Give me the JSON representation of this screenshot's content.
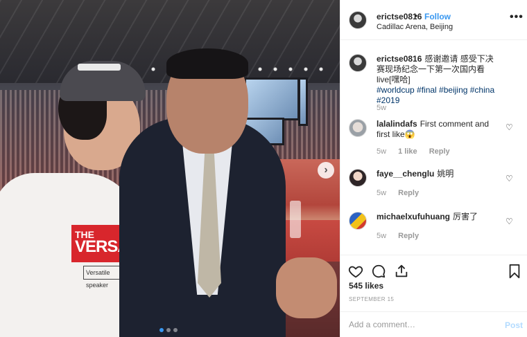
{
  "post": {
    "username": "erictse0816",
    "separator": "•",
    "follow_label": "Follow",
    "location": "Cadillac Arena, Beijing",
    "more_label": "•••"
  },
  "photo": {
    "shirt_line1": "THE",
    "shirt_line2": "VERSACE",
    "shirt_sub": "Versatile speaker",
    "next_glyph": "›",
    "carousel_total": 3,
    "carousel_active": 1
  },
  "caption": {
    "username": "erictse0816",
    "text": "感谢邀请 感受下决赛现场纪念一下第一次国内看live[嘿哈]",
    "hashtags": "#worldcup #final #beijing #china #2019",
    "time": "5w"
  },
  "comments": [
    {
      "username": "lalalindafs",
      "text": "First comment and first like😱",
      "time": "5w",
      "likes": "1 like",
      "reply": "Reply"
    },
    {
      "username": "faye__chenglu",
      "text": "姚明",
      "time": "5w",
      "reply": "Reply"
    },
    {
      "username": "michaelxufuhuang",
      "text": "厉害了",
      "time": "5w",
      "reply": "Reply"
    }
  ],
  "heart_glyph": "♡",
  "actions": {
    "likes": "545 likes",
    "date": "SEPTEMBER 15"
  },
  "add_comment": {
    "placeholder": "Add a comment…",
    "post_label": "Post"
  },
  "colors": {
    "link_blue": "#3897f0",
    "post_disabled": "#b3dbff",
    "hashtag": "#003569",
    "muted": "#999999"
  },
  "icons": [
    "heart-icon",
    "comment-icon",
    "share-icon",
    "bookmark-icon",
    "more-options-icon",
    "next-arrow-icon"
  ]
}
